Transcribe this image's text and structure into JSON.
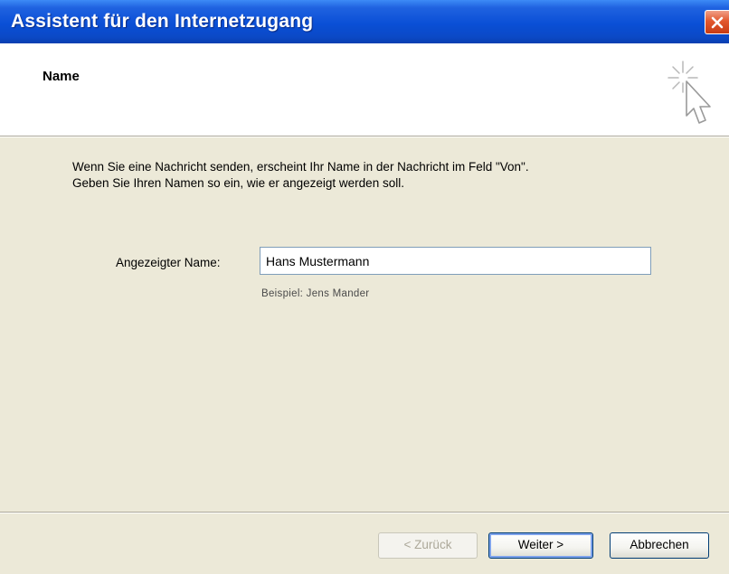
{
  "window": {
    "title": "Assistent für den Internetzugang",
    "close_icon": "close-icon"
  },
  "header": {
    "title": "Name",
    "icon": "wizard-cursor-sparkle-icon"
  },
  "content": {
    "description_line1": "Wenn Sie eine Nachricht senden, erscheint Ihr Name in der Nachricht im Feld \"Von\".",
    "description_line2": "Geben Sie Ihren Namen so ein, wie er angezeigt werden soll.",
    "field_label": "Angezeigter Name:",
    "field_value": "Hans Mustermann",
    "example": "Beispiel: Jens Mander"
  },
  "buttons": {
    "back": "< Zurück",
    "next": "Weiter >",
    "cancel": "Abbrechen"
  },
  "colors": {
    "titlebar": "#0a4fd6",
    "dialog_bg": "#ece9d8",
    "close_button": "#e2582e"
  }
}
